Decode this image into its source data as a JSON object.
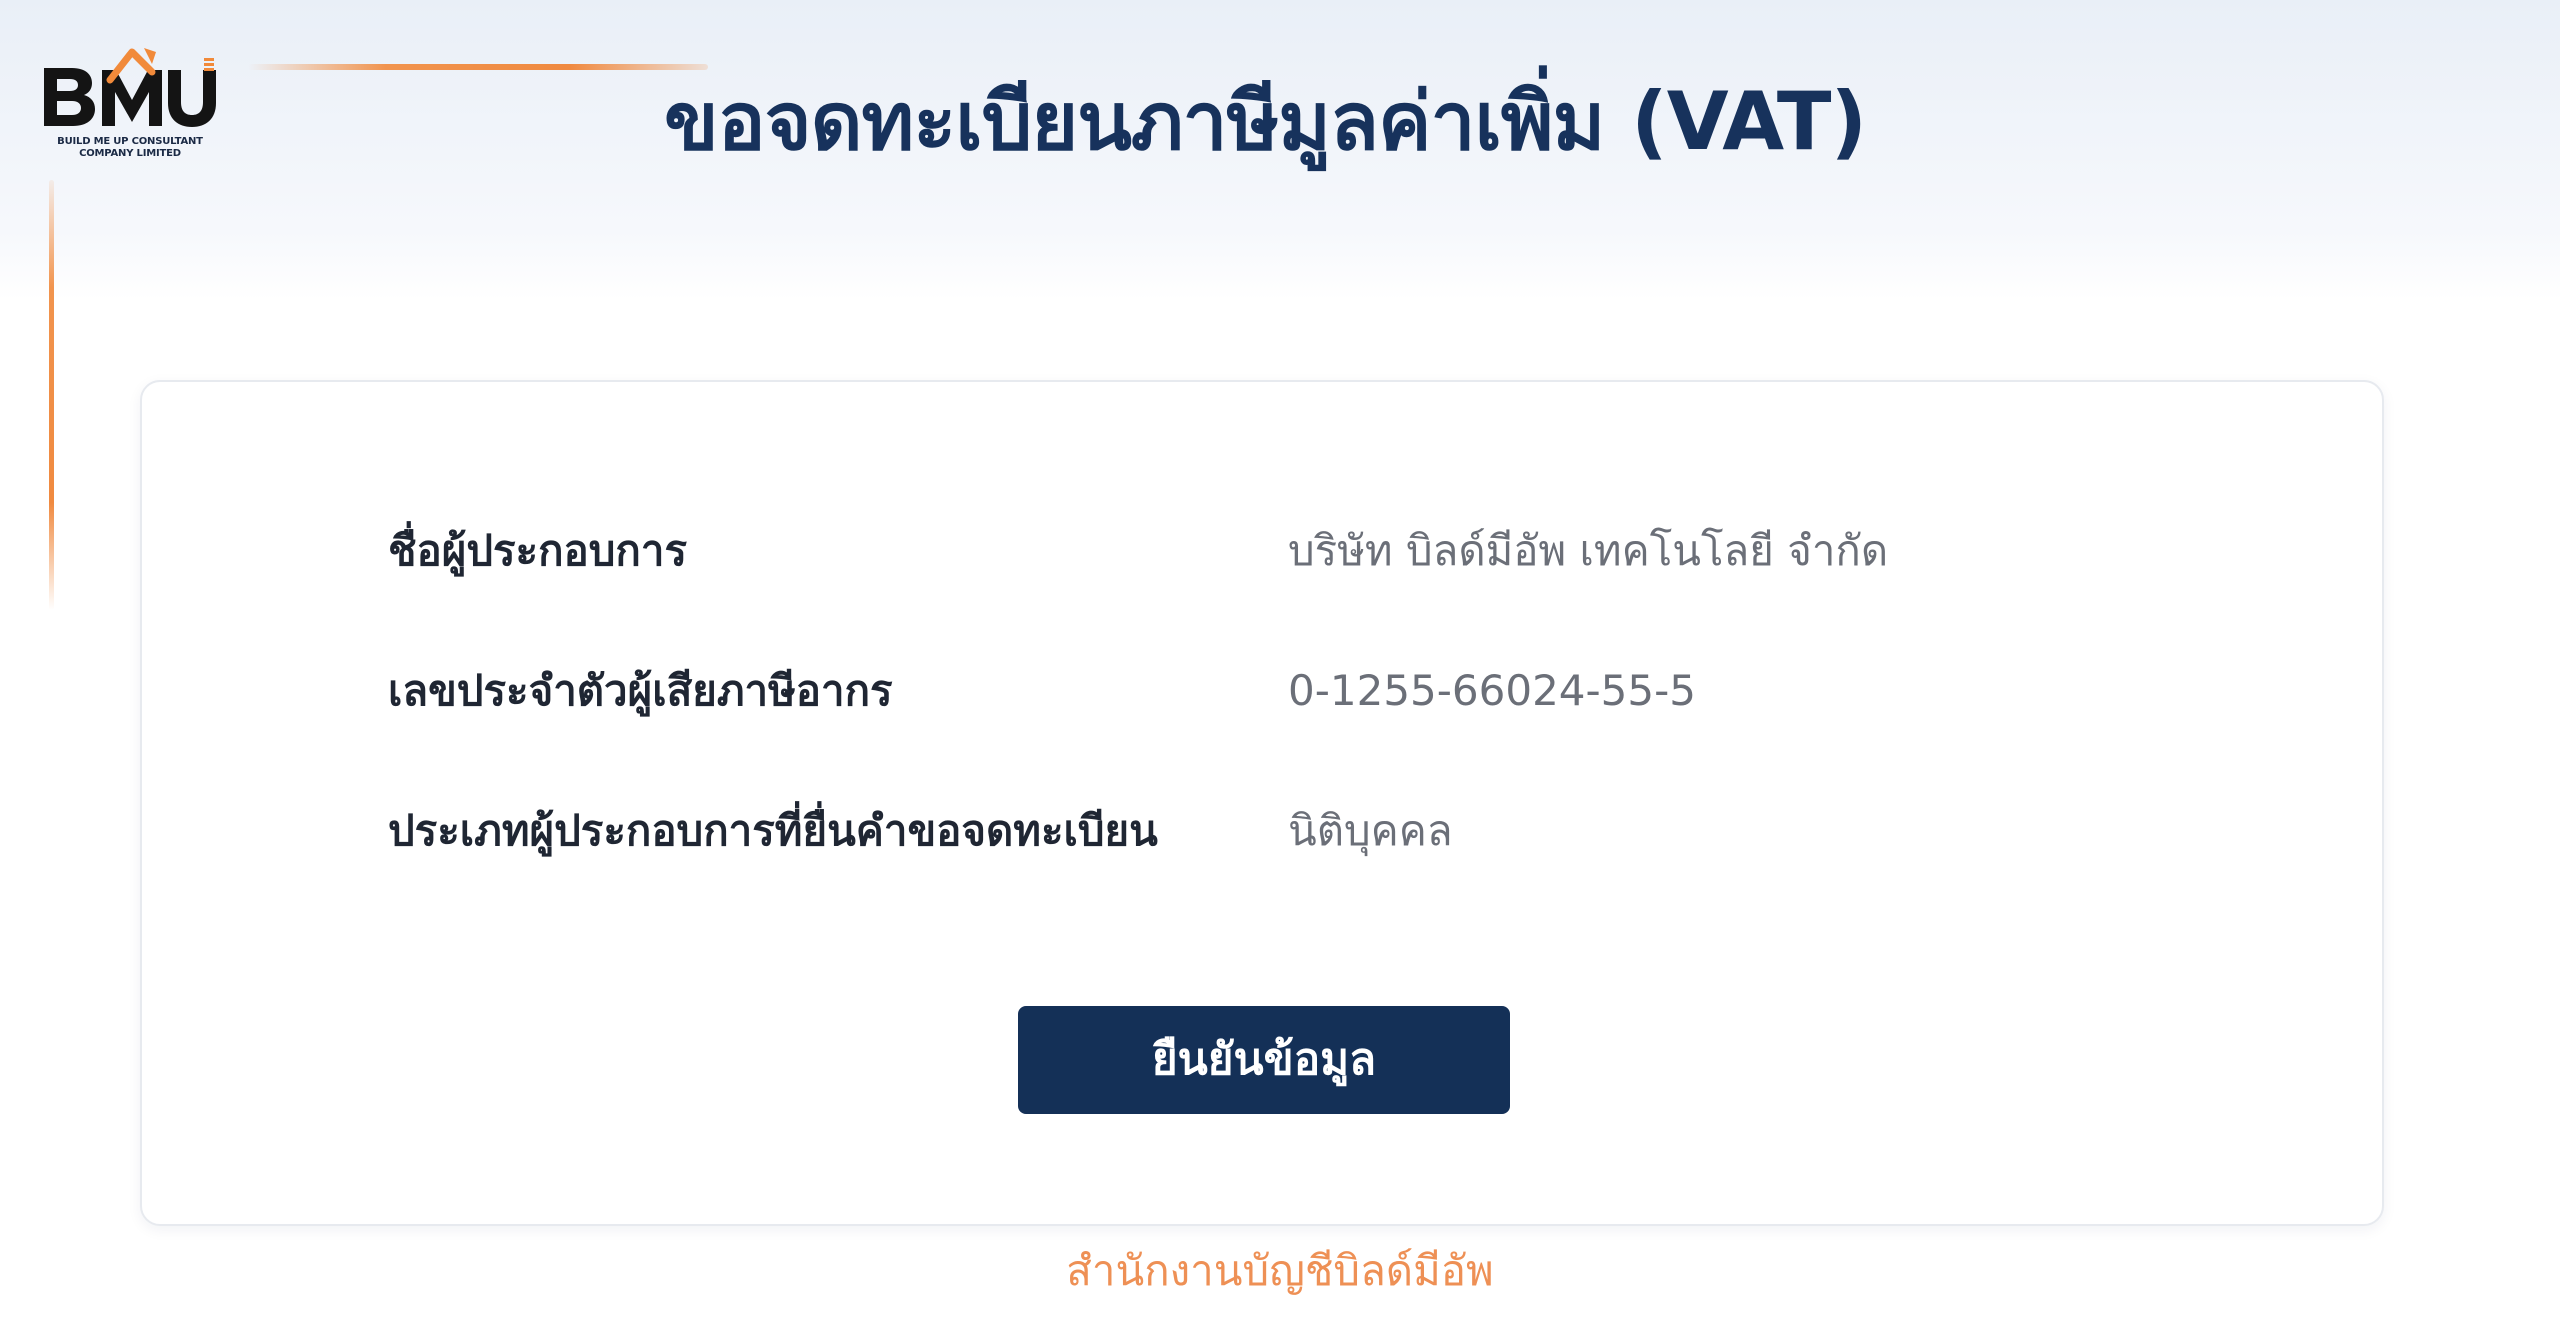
{
  "logo": {
    "wordmark": "BMU",
    "subtitle_line1": "BUILD ME UP CONSULTANT",
    "subtitle_line2": "COMPANY LIMITED"
  },
  "header": {
    "title": "ขอจดทะเบียนภาษีมูลค่าเพิ่ม (VAT)"
  },
  "details": {
    "rows": [
      {
        "label": "ชื่อผู้ประกอบการ",
        "value": "บริษัท บิลด์มีอัพ เทคโนโลยี จำกัด"
      },
      {
        "label": "เลขประจำตัวผู้เสียภาษีอากร",
        "value": "0-1255-66024-55-5"
      },
      {
        "label": "ประเภทผู้ประกอบการที่ยื่นคำขอจดทะเบียน",
        "value": "นิติบุคคล"
      }
    ]
  },
  "actions": {
    "confirm_label": "ยืนยันข้อมูล"
  },
  "footer": {
    "text": "สำนักงานบัญชีบิลด์มีอัพ"
  },
  "colors": {
    "primary_navy": "#143057",
    "title_navy": "#17325c",
    "accent_orange": "#f1944e",
    "footer_orange": "#ee9055"
  }
}
